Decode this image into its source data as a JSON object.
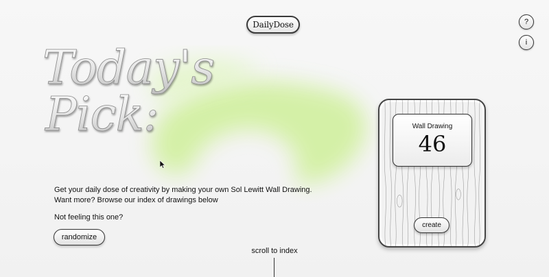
{
  "brand": {
    "label": "DailyDose"
  },
  "header": {
    "help_label": "?",
    "info_label": "i"
  },
  "hero": {
    "title_line1": "Today's",
    "title_line2": "Pick:"
  },
  "intro": {
    "line1": "Get your daily dose of creativity by making your own Sol Lewitt Wall Drawing.",
    "line2": "Want more? Browse our index of drawings below",
    "prompt": "Not feeling this one?",
    "randomize_label": "randomize"
  },
  "card": {
    "title": "Wall Drawing",
    "number": "46",
    "create_label": "create"
  },
  "footer": {
    "scroll_label": "scroll to index"
  },
  "colors": {
    "accent_blob": "#d6f2a8",
    "ink": "#111111",
    "background": "#f4f4f4"
  },
  "icons": {
    "cursor": "mouse-pointer-icon"
  }
}
